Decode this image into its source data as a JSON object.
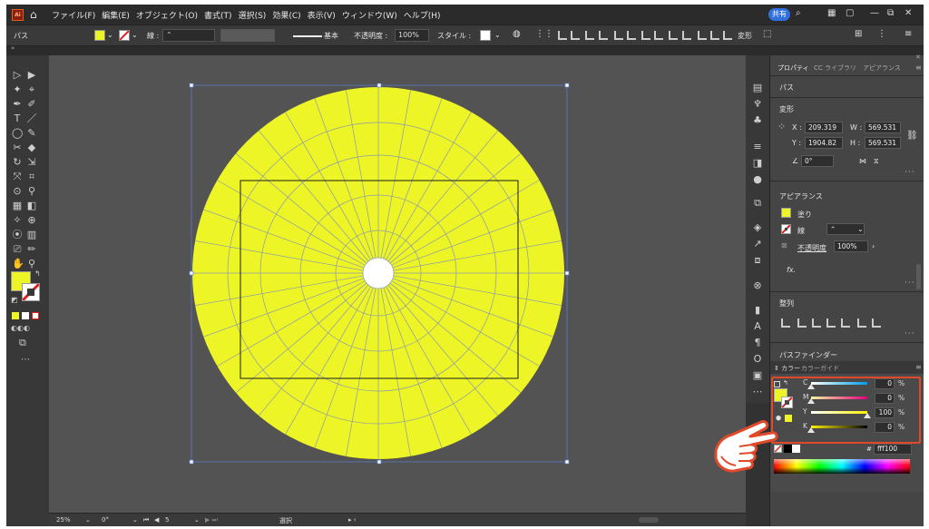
{
  "menubar": {
    "logo_text": "Ai",
    "items": [
      "ファイル(F)",
      "編集(E)",
      "オブジェクト(O)",
      "書式(T)",
      "選択(S)",
      "効果(C)",
      "表示(V)",
      "ウィンドウ(W)",
      "ヘルプ(H)"
    ],
    "share_label": "共有",
    "window_controls": [
      "—",
      "⧉",
      "✕"
    ]
  },
  "controlbar": {
    "object_type": "パス",
    "stroke_label": "線 :",
    "stroke_profile": "基本",
    "opacity_label": "不透明度 :",
    "opacity_value": "100%",
    "style_label": "スタイル :",
    "transform_label": "変形",
    "fill_color": "#eef527"
  },
  "canvas": {
    "artboard_fill": "#eef527",
    "circle_color": "#eef527"
  },
  "statusbar": {
    "zoom": "25%",
    "rotation": "0°",
    "artboard_index": "5",
    "mode": "選択"
  },
  "panel": {
    "tabs": [
      "プロパティ",
      "CC ライブラリ",
      "アピアランス"
    ],
    "object_kind": "パス",
    "transform_title": "変形",
    "x_label": "X :",
    "x_value": "209.319",
    "y_label": "Y :",
    "y_value": "1904.82",
    "w_label": "W :",
    "w_value": "569.531",
    "h_label": "H :",
    "h_value": "569.531",
    "angle_value": "0°",
    "appearance_title": "アピアランス",
    "fill_label": "塗り",
    "stroke_label": "線",
    "opacity_label": "不透明度",
    "opacity_value": "100%",
    "fx_label": "fx.",
    "align_title": "整列",
    "pathfinder_title": "パスファインダー",
    "color_tabs": [
      "カラー",
      "カラーガイド"
    ],
    "cmyk": [
      {
        "label": "C",
        "value": "0",
        "unit": "%",
        "gradient": "linear-gradient(to right,#ffffff,#00a0e9)",
        "level": 0
      },
      {
        "label": "M",
        "value": "0",
        "unit": "%",
        "gradient": "linear-gradient(to right,#f5f5a0,#e4007f)",
        "level": 0
      },
      {
        "label": "Y",
        "value": "100",
        "unit": "%",
        "gradient": "linear-gradient(to right,#ffffff,#fff100)",
        "level": 100
      },
      {
        "label": "K",
        "value": "0",
        "unit": "%",
        "gradient": "linear-gradient(to right,#fff100,#000000)",
        "level": 0
      }
    ],
    "hex_prefix": "#",
    "hex_value": "fff100"
  },
  "colors": {
    "accent": "#2f6fde",
    "highlight_box": "#e04a2a",
    "fill_yellow": "#eef527",
    "hand_fill": "#ffffff",
    "hand_outline": "#e04a2a"
  }
}
